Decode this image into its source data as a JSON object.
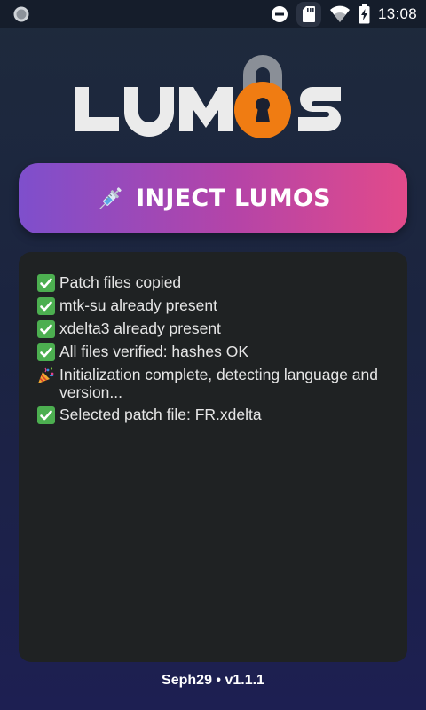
{
  "status_bar": {
    "time": "13:08",
    "icons": [
      "camera-dot-icon",
      "do-not-disturb-icon",
      "sd-card-icon",
      "wifi-icon",
      "battery-charging-icon"
    ]
  },
  "logo": {
    "text": "LUMOS",
    "colors": {
      "letters": "#ebebeb",
      "lock_body": "#f07c12",
      "shackle": "#8a8f97"
    }
  },
  "inject_button": {
    "label": "INJECT LUMOS",
    "icon": "syringe-icon",
    "gradient": [
      "#7e4fcc",
      "#e24a8a"
    ]
  },
  "log": {
    "lines": [
      {
        "icon": "check-mark-icon",
        "text": "Patch files copied"
      },
      {
        "icon": "check-mark-icon",
        "text": "mtk-su already present"
      },
      {
        "icon": "check-mark-icon",
        "text": "xdelta3 already present"
      },
      {
        "icon": "check-mark-icon",
        "text": "All files verified: hashes OK"
      },
      {
        "icon": "party-popper-icon",
        "text": "Initialization complete, detecting language and version..."
      },
      {
        "icon": "check-mark-icon",
        "text": "Selected patch file: FR.xdelta"
      }
    ]
  },
  "footer": {
    "text": "Seph29 • v1.1.1"
  }
}
